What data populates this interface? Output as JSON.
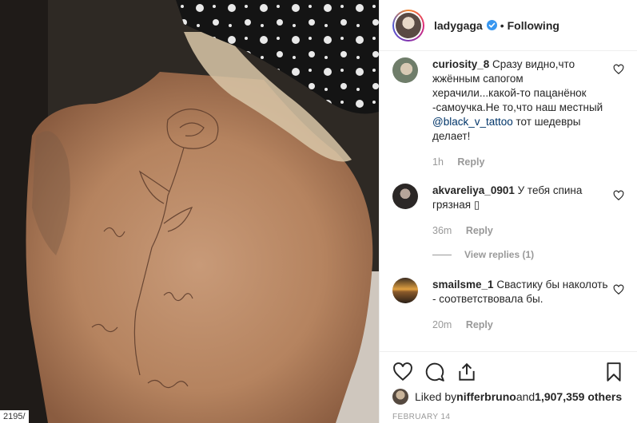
{
  "photo": {
    "id_label": "2195/"
  },
  "header": {
    "username": "ladygaga",
    "separator": "•",
    "follow_status": "Following"
  },
  "comments": [
    {
      "username": "curiosity_8",
      "text_before": " Сразу видно,что жжённым сапогом херачили...какой-то пацанёнок -самоучка.Не то,что наш местный ",
      "mention": "@black_v_tattoo",
      "text_after": " тот шедевры делает!",
      "time": "1h",
      "reply_label": "Reply"
    },
    {
      "username": "akvareliya_0901",
      "text_before": " У тебя спина грязная ",
      "mention": "",
      "text_after": "▯",
      "time": "36m",
      "reply_label": "Reply",
      "view_replies": "View replies (1)"
    },
    {
      "username": "smailsme_1",
      "text_before": " Свастику бы наколоть - соответствовала бы.",
      "mention": "",
      "text_after": "",
      "time": "20m",
      "reply_label": "Reply"
    }
  ],
  "likes": {
    "prefix": "Liked by ",
    "user": "nifferbruno",
    "middle": " and ",
    "count": "1,907,359 others"
  },
  "date": "FEBRUARY 14",
  "icons": {
    "verified": "verified-badge-icon",
    "like": "heart-icon",
    "comment": "comment-icon",
    "share": "share-icon",
    "save": "bookmark-icon"
  },
  "colors": {
    "accent_blue": "#3897f0",
    "mention": "#003569",
    "meta_grey": "#999999",
    "divider": "#efefef"
  }
}
